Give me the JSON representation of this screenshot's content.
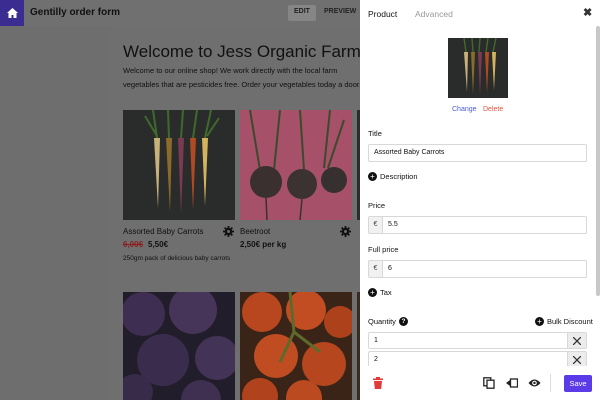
{
  "app": {
    "title": "Gentilly order form",
    "modes": {
      "edit": "EDIT",
      "preview": "PREVIEW"
    }
  },
  "store": {
    "heading": "Welcome to Jess Organic Farm C",
    "intro": "Welcome to our online shop! We work directly with the local farm vegetables that are pesticides free. Order your vegetables today a door.",
    "products": [
      {
        "name": "Assorted Baby Carrots",
        "old_price": "6,00€",
        "price": "5,50€",
        "description": "250gm pack of delicious baby carrots"
      },
      {
        "name": "Beetroot",
        "price": "2,50€ per kg"
      }
    ]
  },
  "panel": {
    "tabs": {
      "product": "Product",
      "advanced": "Advanced"
    },
    "image_actions": {
      "change": "Change",
      "delete": "Delete"
    },
    "title_label": "Title",
    "title_value": "Assorted Baby Carrots",
    "description_add": "Description",
    "price_label": "Price",
    "currency_symbol": "€",
    "price_value": "5.5",
    "full_price_label": "Full price",
    "full_price_value": "6",
    "tax_add": "Tax",
    "quantity_label": "Quantity",
    "quantity_help": "?",
    "bulk_discount": "Bulk Discount",
    "quantities": [
      "1",
      "2"
    ],
    "save_label": "Save"
  },
  "colors": {
    "accent": "#5b3be8",
    "home": "#3b2c92",
    "link_change": "#4a5ae0",
    "link_delete": "#e0533f",
    "trash": "#e03a3a"
  },
  "icons": [
    "home-icon",
    "close-icon",
    "settings-gear-icon",
    "plus-circle-icon",
    "help-icon",
    "clear-x-icon",
    "trash-icon",
    "duplicate-icon",
    "move-icon",
    "preview-eye-icon"
  ]
}
